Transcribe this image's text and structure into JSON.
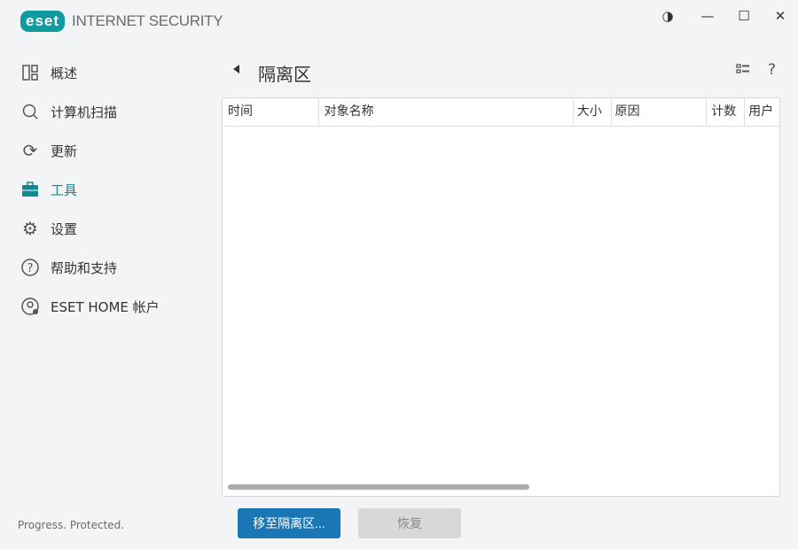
{
  "app": {
    "logo": "eset",
    "product": "INTERNET SECURITY"
  },
  "window": {
    "theme_icon": "contrast-icon",
    "minimize": "minimize-icon",
    "maximize": "maximize-icon",
    "close": "close-icon"
  },
  "sidebar": {
    "items": [
      {
        "label": "概述",
        "icon": "overview-icon"
      },
      {
        "label": "计算机扫描",
        "icon": "search-icon"
      },
      {
        "label": "更新",
        "icon": "refresh-icon"
      },
      {
        "label": "工具",
        "icon": "toolbox-icon",
        "active": true
      },
      {
        "label": "设置",
        "icon": "gear-icon"
      },
      {
        "label": "帮助和支持",
        "icon": "help-icon"
      },
      {
        "label": "ESET HOME 帐户",
        "icon": "account-icon"
      }
    ],
    "footer": "Progress. Protected."
  },
  "page": {
    "title": "隔离区",
    "help": "?"
  },
  "table": {
    "columns": [
      "时间",
      "对象名称",
      "大小",
      "原因",
      "计数",
      "用户"
    ],
    "rows": []
  },
  "buttons": {
    "quarantine": "移至隔离区...",
    "restore": "恢复"
  },
  "colors": {
    "accent": "#0f9a9f",
    "primary": "#1a77b6"
  }
}
